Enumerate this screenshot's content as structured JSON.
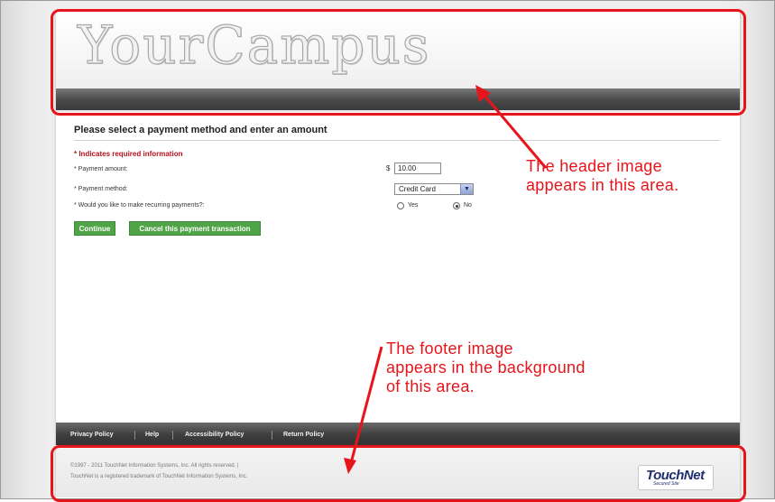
{
  "header": {
    "logo_text": "YourCampus"
  },
  "form": {
    "title": "Please select a payment method and enter an amount",
    "required_note": "* Indicates required information",
    "fields": [
      {
        "label": "* Payment amount:",
        "currency": "$",
        "value": "10.00"
      },
      {
        "label": "* Payment method:",
        "selected": "Credit Card"
      },
      {
        "label": "* Would you like to make recurring payments?:",
        "options": [
          "Yes",
          "No"
        ],
        "checked": "No"
      }
    ],
    "buttons": {
      "continue": "Continue",
      "cancel": "Cancel this payment transaction"
    }
  },
  "footer": {
    "nav": [
      "Privacy Policy",
      "Help",
      "Accessibility Policy",
      "Return Policy"
    ],
    "copyright_line1": "©1997 - 2011 TouchNet Information Systems, Inc. All rights reserved. |",
    "copyright_line2": "TouchNet is a registered trademark of TouchNet Information Systems, Inc.",
    "logo_text": "TouchNet",
    "logo_sub": "Secured Site"
  },
  "annotations": {
    "header": [
      "The header image",
      "appears in this area."
    ],
    "footer": [
      "The footer image",
      "appears in the background",
      "of this area."
    ]
  },
  "colors": {
    "annotation": "#e8141b",
    "button": "#4fa447",
    "required": "#b3111c"
  },
  "icons": {
    "select_arrow": "chevron-down-icon",
    "logo": "touchnet-logo-icon"
  }
}
